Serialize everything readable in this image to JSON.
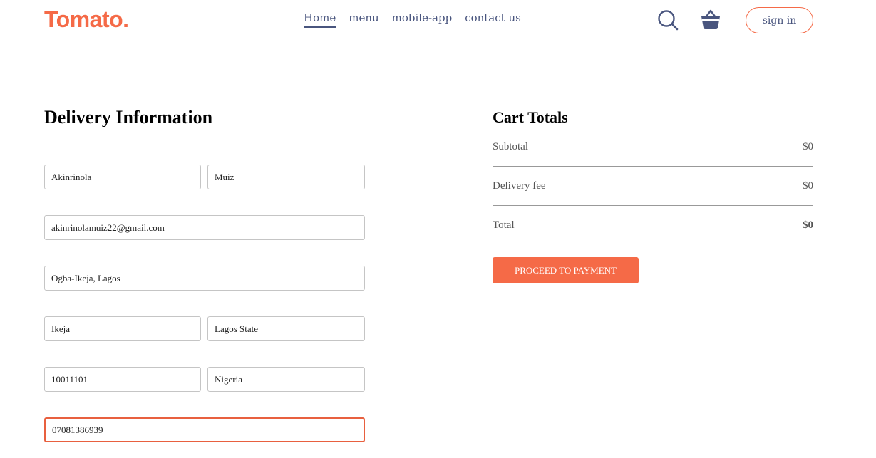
{
  "header": {
    "logo": "Tomato.",
    "nav": [
      "Home",
      "menu",
      "mobile-app",
      "contact us"
    ],
    "active_nav": "Home",
    "signin_label": "sign in",
    "icons": [
      "search-icon",
      "basket-icon"
    ]
  },
  "delivery": {
    "title": "Delivery Information",
    "first_name": "Akinrinola",
    "last_name": "Muiz",
    "email": "akinrinolamuiz22@gmail.com",
    "street": "Ogba-Ikeja, Lagos",
    "city": "Ikeja",
    "state": "Lagos State",
    "zip": "10011101",
    "country": "Nigeria",
    "phone": "07081386939"
  },
  "cart": {
    "title": "Cart Totals",
    "subtotal_label": "Subtotal",
    "subtotal_value": "$0",
    "delivery_label": "Delivery fee",
    "delivery_value": "$0",
    "total_label": "Total",
    "total_value": "$0",
    "pay_button": "PROCEED TO PAYMENT"
  },
  "colors": {
    "accent": "#f56a47",
    "text": "#49557e"
  }
}
